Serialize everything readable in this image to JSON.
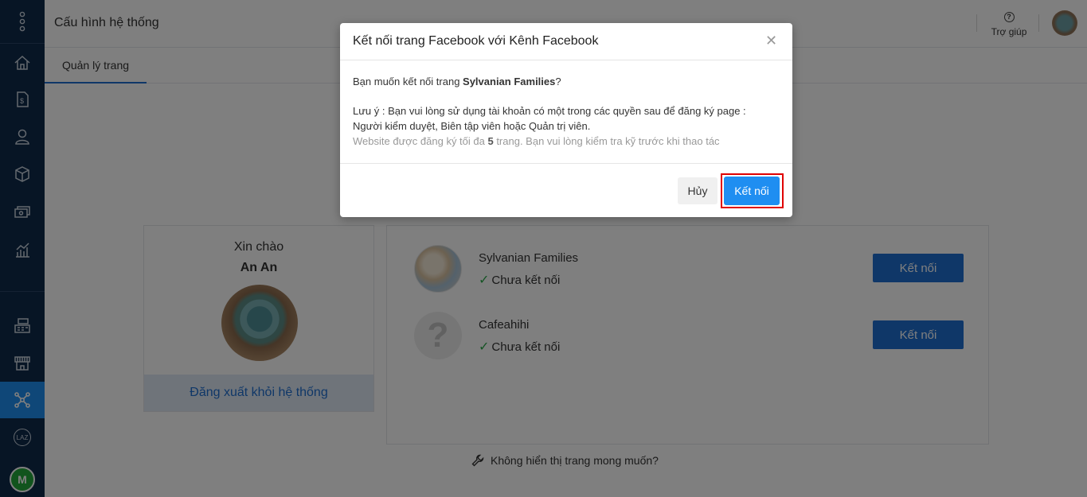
{
  "header": {
    "title": "Cấu hình hệ thống",
    "help_label": "Trợ giúp"
  },
  "tabs": [
    {
      "label": "Quản lý trang"
    }
  ],
  "sidebar": {
    "items": [
      {
        "icon": "apps-menu-icon"
      },
      {
        "icon": "home-icon"
      },
      {
        "icon": "invoice-icon"
      },
      {
        "icon": "user-icon"
      },
      {
        "icon": "box-icon"
      },
      {
        "icon": "money-icon"
      },
      {
        "icon": "chart-icon"
      },
      {
        "icon": "cash-register-icon"
      },
      {
        "icon": "store-icon"
      },
      {
        "icon": "share-network-icon",
        "active": true
      },
      {
        "icon": "lazada-icon",
        "label": "LAZ"
      },
      {
        "icon": "avatar",
        "label": "M"
      }
    ]
  },
  "profile": {
    "greeting": "Xin chào",
    "name": "An An",
    "logout_label": "Đăng xuất khỏi hệ thống"
  },
  "pages": [
    {
      "name": "Sylvanian Families",
      "status": "Chưa kết nối",
      "button": "Kết nối"
    },
    {
      "name": "Cafeahihi",
      "status": "Chưa kết nối",
      "button": "Kết nối"
    }
  ],
  "missing_link": "Không hiển thị trang mong muốn?",
  "modal": {
    "title": "Kết nối trang Facebook với Kênh Facebook",
    "question_prefix": "Bạn muốn kết nối trang ",
    "question_page": "Sylvanian Families",
    "question_suffix": "?",
    "note_line1": "Lưu ý : Bạn vui lòng sử dụng tài khoản có một trong các quyền sau để đăng ký page :",
    "note_line2": "Người kiểm duyệt, Biên tập viên hoặc Quản trị viên.",
    "limit_prefix": "Website được đăng ký tối đa ",
    "limit_count": "5",
    "limit_suffix": " trang. Bạn vui lòng kiểm tra kỹ trước khi thao tác",
    "cancel_label": "Hủy",
    "confirm_label": "Kết nối"
  },
  "colors": {
    "sidebar_bg": "#0f2a4a",
    "accent": "#1f8ef1",
    "primary_button": "#1f6fd0",
    "highlight_border": "#e00000",
    "status_check": "#2ba84a"
  }
}
